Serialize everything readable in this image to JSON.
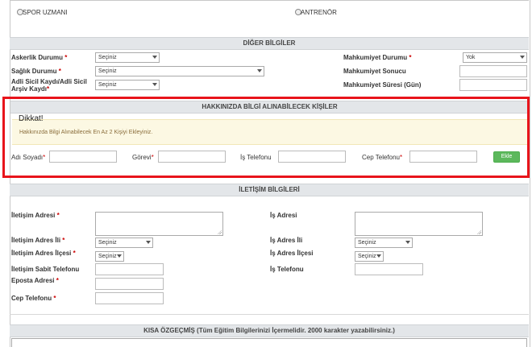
{
  "top_radios": {
    "option1": "SPOR UZMANI",
    "option2": "ANTRENÖR"
  },
  "diger": {
    "title": "DİĞER BİLGİLER",
    "askerlik_label": "Askerlik Durumu",
    "askerlik_value": "Seçiniz",
    "saglik_label": "Sağlık Durumu",
    "saglik_value": "Seçiniz",
    "adli_label_line1": "Adli Sicil Kaydı/Adli Sicil",
    "adli_label_line2": "Arşiv Kaydı",
    "adli_value": "Seçiniz",
    "mahkumiyet_durumu_label": "Mahkumiyet Durumu",
    "mahkumiyet_durumu_value": "Yok",
    "mahkumiyet_sonucu_label": "Mahkumiyet Sonucu",
    "mahkumiyet_suresi_label": "Mahkumiyet Süresi (Gün)"
  },
  "hakkinda": {
    "title": "HAKKINIZDA BİLGİ ALINABİLECEK KİŞİLER",
    "alert_title": "Dikkat!",
    "alert_text": "Hakkınızda Bilgi Alınabilecek En Az 2 Kişiyi Ekleyiniz.",
    "ad_soyad_label": "Adı Soyadı",
    "gorevi_label": "Görevi",
    "is_telefonu_label": "İş Telefonu",
    "cep_telefonu_label": "Cep Telefonu",
    "ekle_button": "Ekle"
  },
  "iletisim": {
    "title": "İLETİŞİM BİLGİLERİ",
    "iletisim_adresi_label": "İletişim Adresi",
    "is_adresi_label": "İş Adresi",
    "iletisim_adres_ili_label": "İletişim Adres İli",
    "iletisim_adres_ili_value": "Seçiniz",
    "is_adres_ili_label": "İş Adres İli",
    "is_adres_ili_value": "Seçiniz",
    "iletisim_adres_ilcesi_label": "İletişim Adres İlçesi",
    "iletisim_adres_ilcesi_value": "Seçiniz",
    "is_adres_ilcesi_label": "İş Adres İlçesi",
    "is_adres_ilcesi_value": "Seçiniz",
    "sabit_telefon_label": "İletişim Sabit Telefonu",
    "is_telefonu_label": "İş Telefonu",
    "eposta_label": "Eposta Adresi",
    "cep_telefonu_label": "Cep Telefonu"
  },
  "ozgecmis": {
    "title": "KISA ÖZGEÇMİŞ (Tüm Eğitim Bilgilerinizi İçermelidir. 2000 karakter yazabilirsiniz.)"
  },
  "colors": {
    "required": "#cc0000",
    "highlight": "#e8141b",
    "button": "#5cb85c",
    "alert_bg": "#fcf8e3"
  }
}
